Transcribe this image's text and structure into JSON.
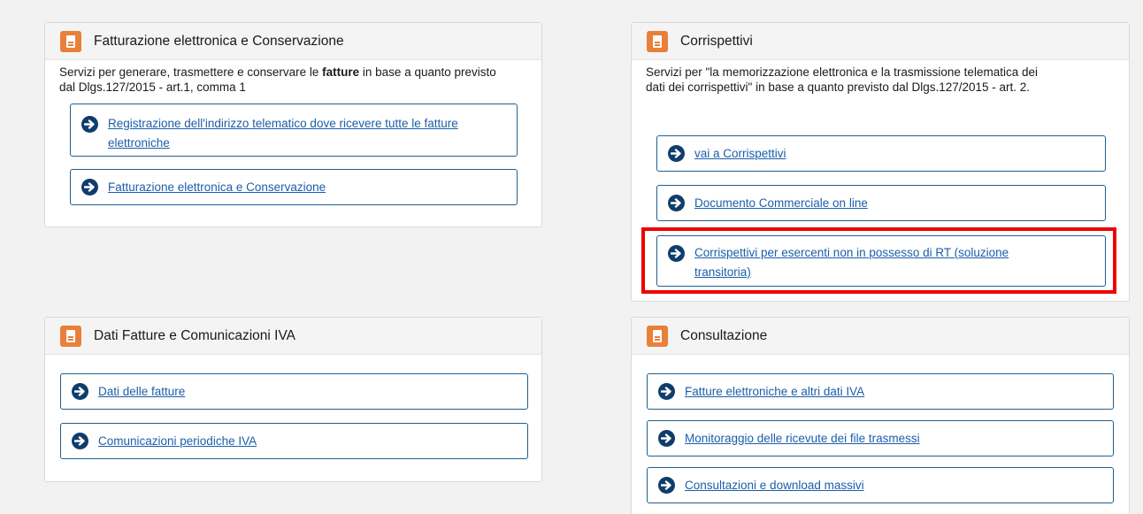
{
  "panels": {
    "fatturazione": {
      "title": "Fatturazione elettronica e Conservazione",
      "desc_pre": "Servizi per generare, trasmettere e conservare le ",
      "desc_bold": "fatture",
      "desc_post": " in base a quanto previsto dal Dlgs.127/2015 - art.1, comma 1",
      "links": [
        "Registrazione dell'indirizzo telematico dove ricevere tutte le fatture elettroniche",
        "Fatturazione elettronica e Conservazione"
      ]
    },
    "corrispettivi": {
      "title": "Corrispettivi",
      "desc": "Servizi per \"la memorizzazione elettronica e la trasmissione telematica dei dati dei corrispettivi\" in base a quanto previsto dal Dlgs.127/2015 - art. 2.",
      "links": [
        "vai a Corrispettivi",
        "Documento Commerciale on line",
        "Corrispettivi per esercenti non in possesso di RT (soluzione transitoria)"
      ]
    },
    "dati_fatture": {
      "title": "Dati Fatture e Comunicazioni IVA",
      "links": [
        "Dati delle fatture",
        "Comunicazioni periodiche IVA"
      ]
    },
    "consultazione": {
      "title": "Consultazione",
      "links": [
        "Fatture elettroniche e altri dati IVA",
        "Monitoraggio delle ricevute dei file trasmessi",
        "Consultazioni e download massivi"
      ]
    }
  },
  "colors": {
    "icon_orange": "#e8803a",
    "arrow_navy": "#0f3d6b",
    "link_blue": "#1b5ea8",
    "highlight_red": "#ee0000"
  },
  "icons": {
    "panel": "document-icon",
    "link": "arrow-circle-right-icon"
  }
}
